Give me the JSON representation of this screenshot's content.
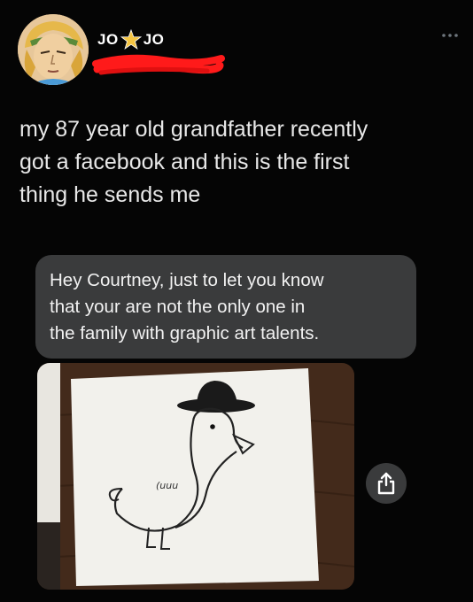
{
  "author": {
    "display_name_left": "JO",
    "display_name_right": "JO",
    "name_separator_icon": "star-icon"
  },
  "tweet": {
    "text": "my 87 year old grandfather recently\ngot a facebook and this is the first\nthing he sends me"
  },
  "message": {
    "text": "Hey Courtney, just to let you know\nthat your are not the only one in\nthe family with graphic art talents."
  },
  "drawing": {
    "scribble": "(uuu"
  },
  "icons": {
    "more": "more-dots-icon",
    "share": "share-icon"
  },
  "colors": {
    "background": "#050505",
    "bubble": "#3a3b3c",
    "redaction": "#ff1a1a",
    "star": "#f5c542"
  }
}
